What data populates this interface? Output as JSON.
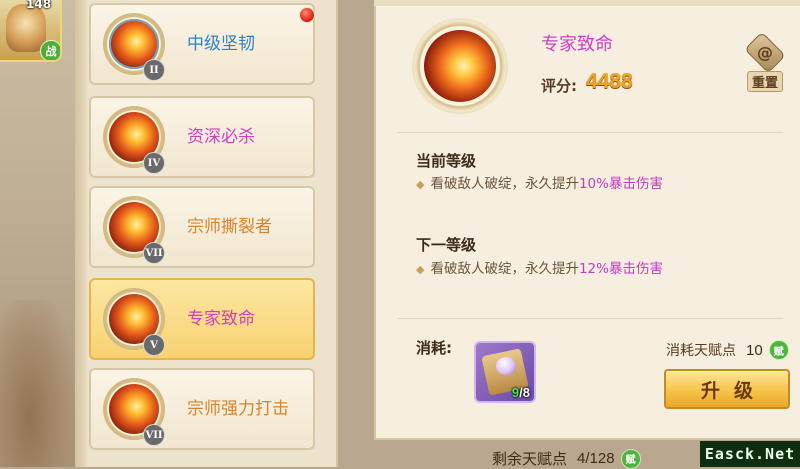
{
  "hero": {
    "level": "148",
    "battle_badge": "战"
  },
  "talent_list": [
    {
      "name": "中级坚韧",
      "rank": "II",
      "name_color": "#2f82c9",
      "alert": true,
      "selected": false
    },
    {
      "name": "资深必杀",
      "rank": "IV",
      "name_color": "#cf3fbf",
      "alert": false,
      "selected": false
    },
    {
      "name": "宗师撕裂者",
      "rank": "VII",
      "name_color": "#d9822b",
      "alert": false,
      "selected": false
    },
    {
      "name": "专家致命",
      "rank": "V",
      "name_color": "#cf3fbf",
      "alert": false,
      "selected": true
    },
    {
      "name": "宗师强力打击",
      "rank": "VII",
      "name_color": "#d9822b",
      "alert": false,
      "selected": false
    }
  ],
  "detail": {
    "title": "专家致命",
    "score_label": "评分:",
    "score_value": "4488",
    "reset_label": "重置",
    "current_level": {
      "heading": "当前等级",
      "desc_prefix": "看破敌人破绽，永久提升",
      "desc_highlight": "10%暴击伤害"
    },
    "next_level": {
      "heading": "下一等级",
      "desc_prefix": "看破敌人破绽，永久提升",
      "desc_highlight": "12%暴击伤害"
    },
    "cost_label": "消耗:",
    "cost_item": {
      "have": "9",
      "need": "/8"
    },
    "talent_cost_label": "消耗天赋点",
    "talent_cost_value": "10",
    "talent_point_icon_glyph": "赋",
    "upgrade_label": "升级"
  },
  "remaining": {
    "label": "剩余天赋点",
    "value": "4/128",
    "icon_glyph": "赋"
  },
  "watermark": "Easck.Net",
  "colors": {
    "accent_purple": "#cf3fbf",
    "score_gold": "#f0a21a",
    "upgrade_gold": "#f6c44a"
  }
}
